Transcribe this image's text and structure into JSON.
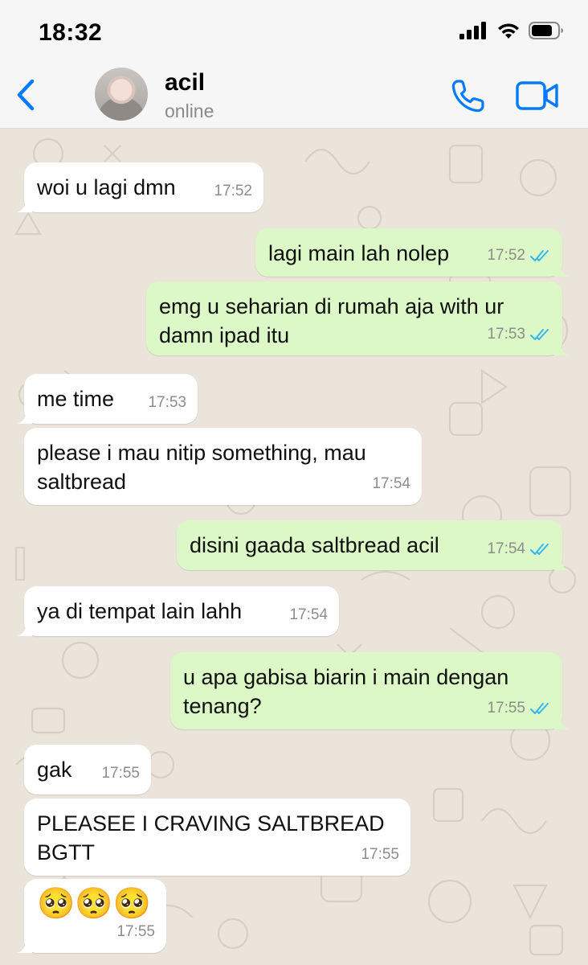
{
  "status_bar": {
    "time": "18:32",
    "icons": [
      "cellular-signal-icon",
      "wifi-icon",
      "battery-icon"
    ]
  },
  "header": {
    "back_icon": "chevron-left-icon",
    "contact_name": "acil",
    "contact_status": "online",
    "call_icon": "phone-icon",
    "video_icon": "video-camera-icon",
    "accent": "#007aff"
  },
  "colors": {
    "incoming_bubble": "#ffffff",
    "outgoing_bubble": "#dcf8c6",
    "read_ticks": "#34b7f1",
    "chat_background": "#ebe4db"
  },
  "messages": [
    {
      "direction": "in",
      "text": "woi u lagi dmn",
      "time": "17:52"
    },
    {
      "direction": "out",
      "text": "lagi main lah nolep",
      "time": "17:52",
      "status": "read"
    },
    {
      "direction": "out",
      "text": "emg u seharian di rumah aja with ur damn ipad itu",
      "time": "17:53",
      "status": "read"
    },
    {
      "direction": "in",
      "text": "me time",
      "time": "17:53"
    },
    {
      "direction": "in",
      "text": "please i mau nitip something, mau saltbread",
      "time": "17:54"
    },
    {
      "direction": "out",
      "text": "disini gaada saltbread acil",
      "time": "17:54",
      "status": "read"
    },
    {
      "direction": "in",
      "text": "ya di tempat lain lahh",
      "time": "17:54"
    },
    {
      "direction": "out",
      "text": "u apa gabisa biarin i main dengan tenang?",
      "time": "17:55",
      "status": "read"
    },
    {
      "direction": "in",
      "text": "gak",
      "time": "17:55"
    },
    {
      "direction": "in",
      "text": "PLEASEE I CRAVING SALTBREAD BGTT",
      "time": "17:55"
    },
    {
      "direction": "in",
      "text": "🥺🥺🥺",
      "time": "17:55"
    }
  ]
}
